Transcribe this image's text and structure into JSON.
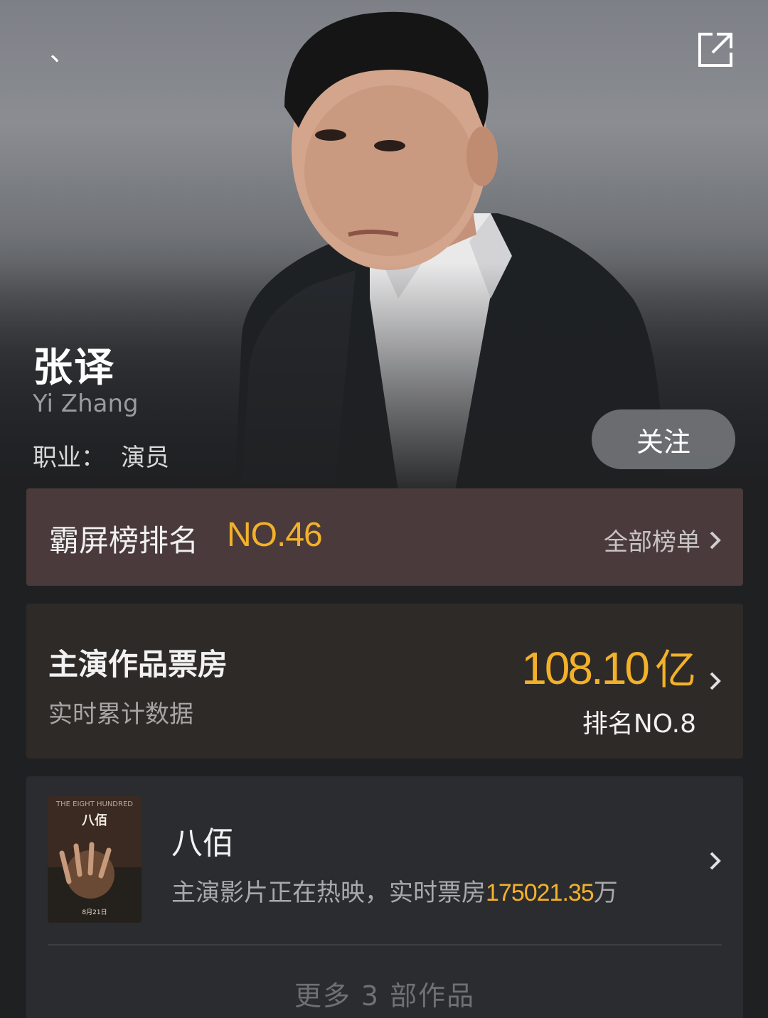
{
  "header": {
    "back_icon": "back-icon",
    "share_icon": "share-icon"
  },
  "actor": {
    "name_cn": "张译",
    "name_en": "Yi Zhang",
    "job_label": "职业：",
    "job_value": "演员",
    "follow_label": "关注"
  },
  "rank": {
    "title": "霸屏榜排名",
    "value": "NO.46",
    "link_label": "全部榜单",
    "accent_color": "#f3b12a"
  },
  "box_office": {
    "title": "主演作品票房",
    "subtitle": "实时累计数据",
    "amount": "108.10",
    "unit": "亿",
    "rank_text": "排名NO.8"
  },
  "works": {
    "movie_title": "八佰",
    "desc_prefix": "主演影片正在热映，实时票房",
    "desc_amount": "175021.35",
    "desc_suffix": "万",
    "poster": {
      "title_en": "THE EIGHT HUNDRED",
      "title_cn": "八佰",
      "date": "8月21日"
    },
    "more_label": "更多 3 部作品"
  }
}
